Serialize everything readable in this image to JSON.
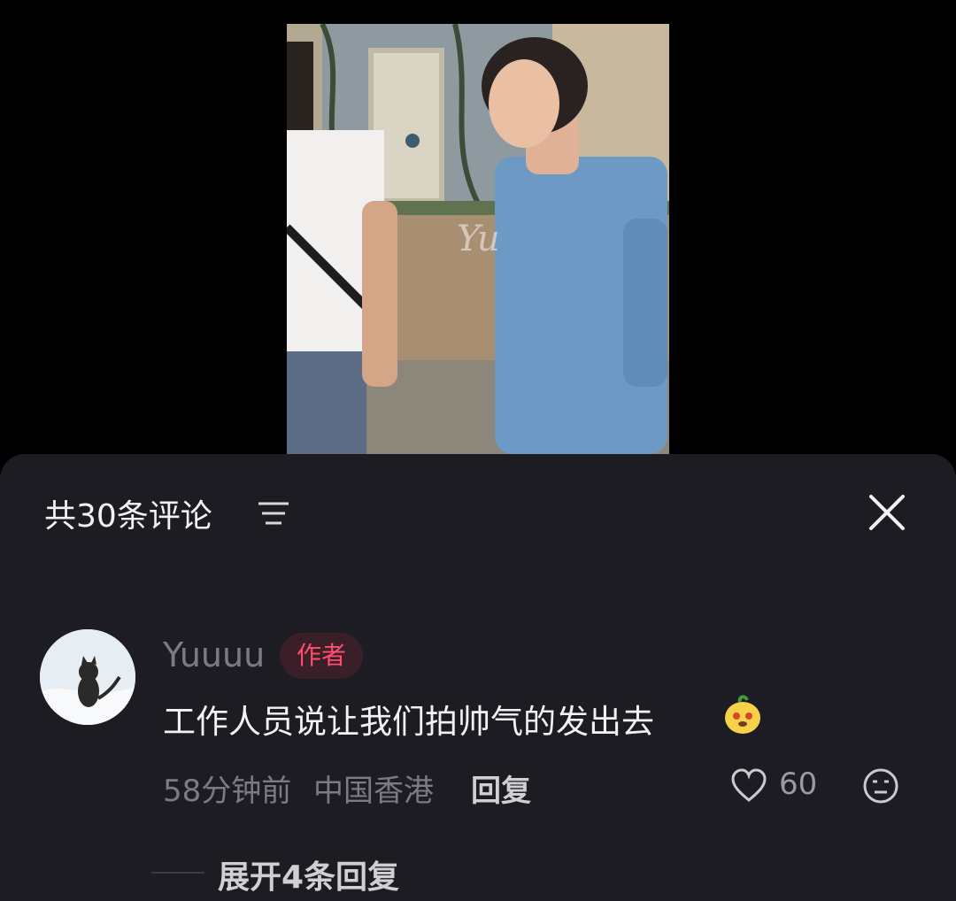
{
  "media": {
    "watermark": "Yu"
  },
  "comments_panel": {
    "title": "共30条评论",
    "comment": {
      "username": "Yuuuu",
      "author_badge": "作者",
      "text": "工作人员说让我们拍帅气的发出去",
      "time": "58分钟前",
      "location": "中国香港",
      "reply_label": "回复",
      "like_count": "60"
    },
    "expand_replies": "展开4条回复"
  },
  "icons": {
    "filter": "filter-icon",
    "close": "close-icon",
    "like": "heart-icon",
    "dislike": "meh-face-icon",
    "emoji": "mango-emoji-icon"
  },
  "colors": {
    "panel_bg": "#1c1c22",
    "badge_text": "#ff4d6d",
    "muted_text": "#7b7b84"
  }
}
